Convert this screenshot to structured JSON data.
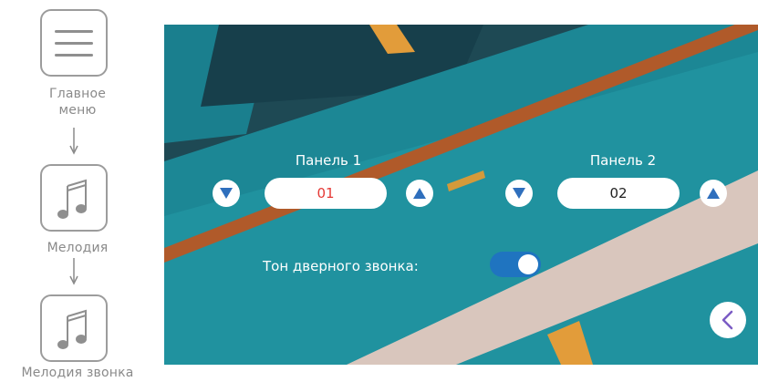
{
  "flow": {
    "main_menu_label": "Главное\nменю",
    "melody_label": "Мелодия",
    "ringtone_label": "Мелодия звонка",
    "icons": [
      "hamburger-menu-icon",
      "music-note-icon",
      "music-note-icon"
    ]
  },
  "screen": {
    "panel1": {
      "title": "Панель 1",
      "value": "01",
      "value_color": "#e53935"
    },
    "panel2": {
      "title": "Панель 2",
      "value": "02",
      "value_color": "#222222"
    },
    "doorbell_tone": {
      "label": "Тон дверного звонка:",
      "enabled": true
    },
    "colors": {
      "toggle_on": "#1f74c0",
      "arrow": "#2f6fbd",
      "back_arrow": "#7b5cc4"
    }
  }
}
